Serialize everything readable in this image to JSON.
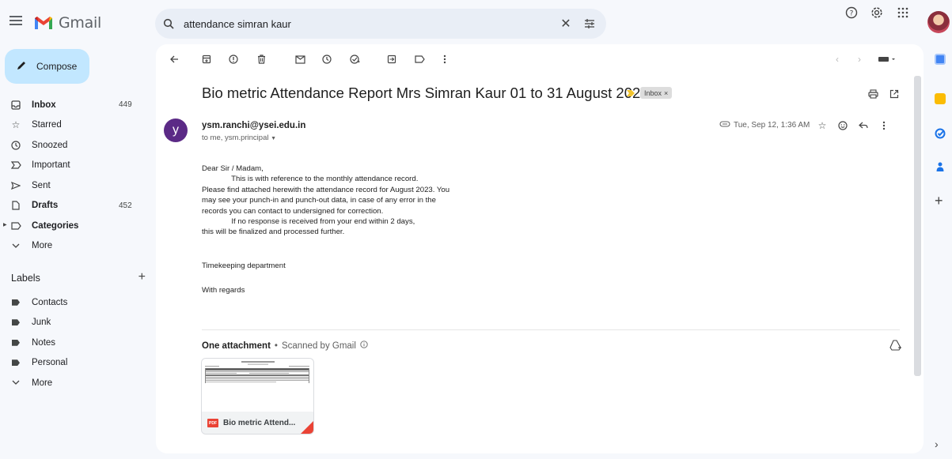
{
  "app": {
    "name": "Gmail"
  },
  "search": {
    "query": "attendance simran kaur"
  },
  "compose": {
    "label": "Compose"
  },
  "nav": [
    {
      "label": "Inbox",
      "count": "449",
      "bold": true,
      "icon": "inbox-icon"
    },
    {
      "label": "Starred",
      "count": "",
      "bold": false,
      "icon": "star-icon"
    },
    {
      "label": "Snoozed",
      "count": "",
      "bold": false,
      "icon": "clock-icon"
    },
    {
      "label": "Important",
      "count": "",
      "bold": false,
      "icon": "important-icon"
    },
    {
      "label": "Sent",
      "count": "",
      "bold": false,
      "icon": "send-icon"
    },
    {
      "label": "Drafts",
      "count": "452",
      "bold": true,
      "icon": "draft-icon"
    },
    {
      "label": "Categories",
      "count": "",
      "bold": true,
      "icon": "label-icon"
    },
    {
      "label": "More",
      "count": "",
      "bold": false,
      "icon": "chevron-down-icon"
    }
  ],
  "labels": {
    "heading": "Labels",
    "items": [
      {
        "label": "Contacts"
      },
      {
        "label": "Junk"
      },
      {
        "label": "Notes"
      },
      {
        "label": "Personal"
      },
      {
        "label": "More"
      }
    ]
  },
  "email": {
    "subject": "Bio metric Attendance Report Mrs Simran Kaur 01 to 31 August 2023",
    "chip": "Inbox",
    "sender_initial": "y",
    "sender": "ysm.ranchi@ysei.edu.in",
    "to": "to me, ysm.principal",
    "date": "Tue, Sep 12, 1:36 AM",
    "body_lines": [
      "Dear Sir / Madam,",
      "              This is with reference to the monthly attendance record.",
      "Please find attached herewith the attendance record for August 2023. You",
      "may see your punch-in and punch-out data, in case of any error in the",
      "records you can contact to undersigned for correction.",
      "              If no response is received from your end within 2 days,",
      "this will be finalized and processed further."
    ],
    "signoff_dept": "Timekeeping department",
    "signoff_regards": "With regards",
    "attachment_heading": "One attachment",
    "attachment_scan": "Scanned by Gmail",
    "attachment_name": "Bio metric Attend...",
    "attachment_type": "PDF"
  },
  "colors": {
    "compose_bg": "#c2e7ff",
    "search_bg": "#e9eef6",
    "avatar_bg": "#5b2a86",
    "important": "#f2c42e",
    "pdf": "#ea4335"
  }
}
